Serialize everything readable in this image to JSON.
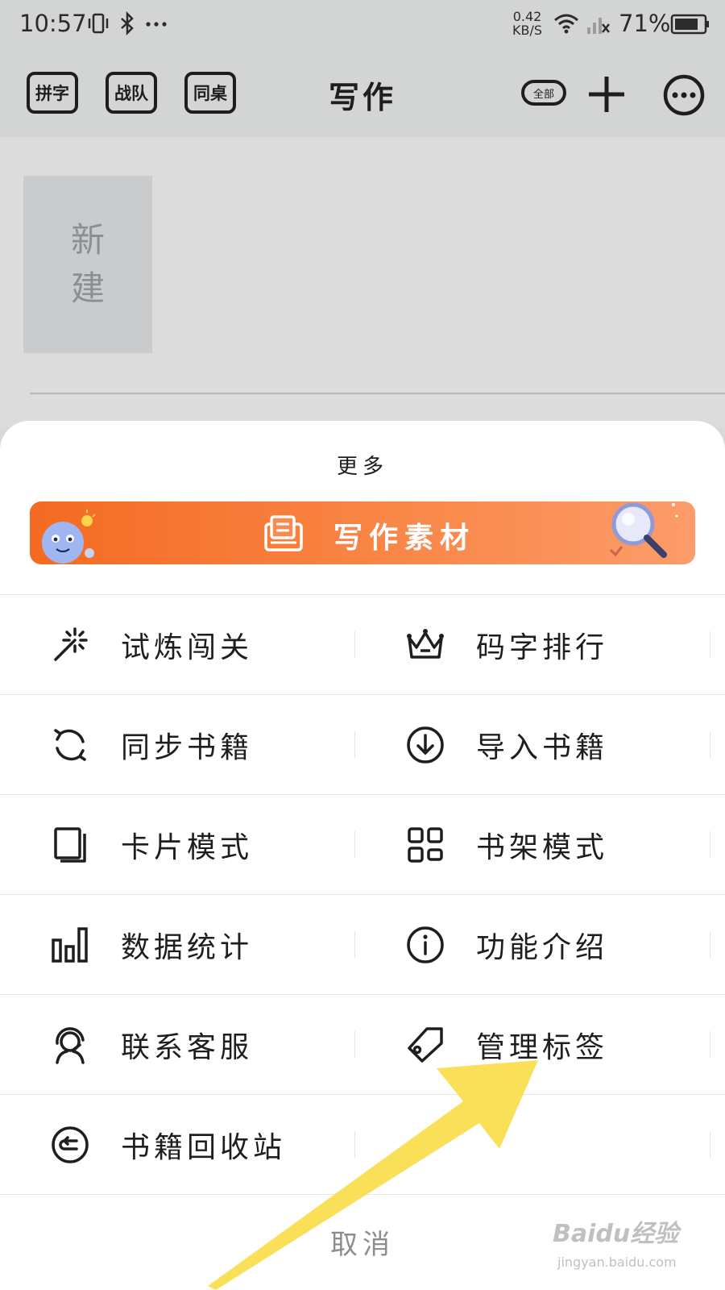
{
  "status_bar": {
    "time": "10:57",
    "net_speed_value": "0.42",
    "net_speed_unit": "KB/S",
    "battery": "71%"
  },
  "header": {
    "buttons": [
      "拼字",
      "战队",
      "同桌"
    ],
    "title": "写作",
    "badge": "全部",
    "icons": [
      "plus-icon",
      "more-icon"
    ]
  },
  "content": {
    "new_card": [
      "新",
      "建"
    ]
  },
  "sheet": {
    "title": "更多",
    "banner_label": "写作素材",
    "rows": [
      [
        {
          "label": "试炼闯关",
          "icon": "magic-wand-icon"
        },
        {
          "label": "码字排行",
          "icon": "crown-icon"
        }
      ],
      [
        {
          "label": "同步书籍",
          "icon": "sync-icon"
        },
        {
          "label": "导入书籍",
          "icon": "download-circle-icon"
        }
      ],
      [
        {
          "label": "卡片模式",
          "icon": "cards-icon"
        },
        {
          "label": "书架模式",
          "icon": "grid-icon"
        }
      ],
      [
        {
          "label": "数据统计",
          "icon": "bar-chart-icon"
        },
        {
          "label": "功能介绍",
          "icon": "info-icon"
        }
      ],
      [
        {
          "label": "联系客服",
          "icon": "headset-icon"
        },
        {
          "label": "管理标签",
          "icon": "tag-icon"
        }
      ],
      [
        {
          "label": "书籍回收站",
          "icon": "recycle-icon"
        }
      ]
    ],
    "cancel": "取消"
  },
  "annotation": {
    "arrow_color": "#f9dd4a"
  },
  "watermark": {
    "brand": "Baidu经验",
    "url": "jingyan.baidu.com"
  },
  "colors": {
    "banner_start": "#f46a23",
    "banner_end": "#fc9c6a",
    "cancel_text": "#8d8d8d"
  }
}
